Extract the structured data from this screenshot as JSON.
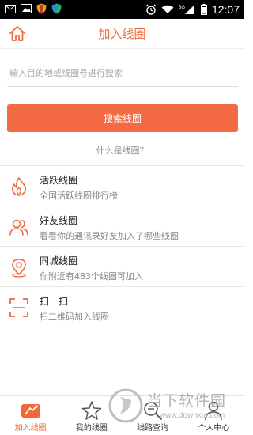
{
  "status_bar": {
    "network": "3G",
    "time": "12:07"
  },
  "header": {
    "title": "加入线圈",
    "home_icon": "home-icon"
  },
  "search": {
    "placeholder": "输入目的地或线圈号进行搜索",
    "value": "",
    "button_label": "搜索线圈"
  },
  "whatis_link": "什么是线圈？",
  "list": [
    {
      "title": "活跃线圈",
      "subtitle": "全国活跃线圈排行榜",
      "icon": "flame-icon"
    },
    {
      "title": "好友线圈",
      "subtitle": "看看你的通讯录好友加入了哪些线圈",
      "icon": "friends-icon"
    },
    {
      "title": "同城线圈",
      "subtitle": "你附近有483个线圈可加入",
      "icon": "location-icon"
    },
    {
      "title": "扫一扫",
      "subtitle": "扫二维码加入线圈",
      "icon": "scan-icon"
    }
  ],
  "bottom_nav": [
    {
      "label": "加入线圈",
      "icon": "circle-join-icon",
      "active": true
    },
    {
      "label": "我的线圈",
      "icon": "star-icon",
      "active": false
    },
    {
      "label": "线路查询",
      "icon": "search-icon",
      "active": false
    },
    {
      "label": "个人中心",
      "icon": "user-icon",
      "active": false
    }
  ],
  "watermark": {
    "text": "当下软件园",
    "url": "www.downxia.com"
  },
  "colors": {
    "accent": "#f36a43",
    "title": "#f2683b"
  }
}
